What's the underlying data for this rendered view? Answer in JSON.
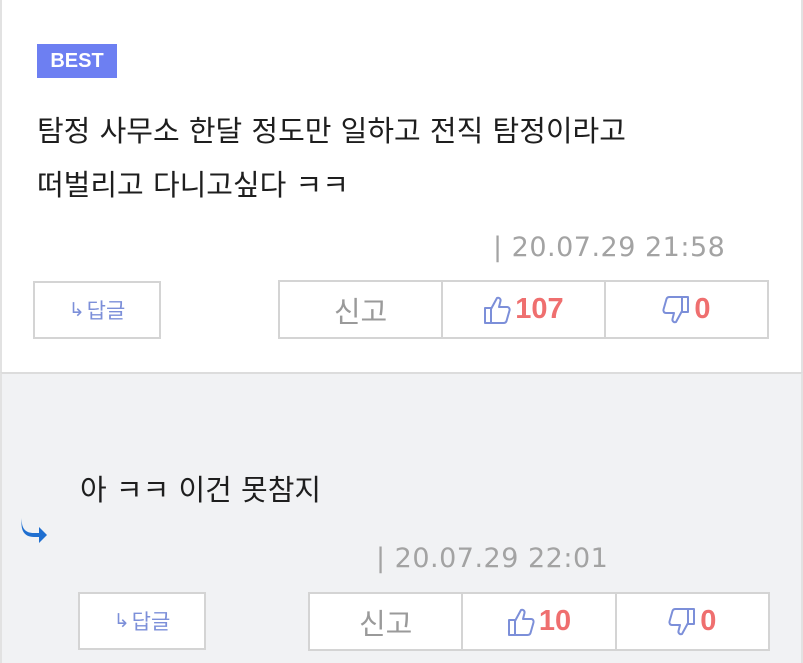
{
  "best_comment": {
    "badge": "BEST",
    "text_line1": "탐정 사무소 한달 정도만 일하고 전직 탐정이라고",
    "text_line2": "떠벌리고 다니고싶다 ㅋㅋ",
    "timestamp": "| 20.07.29 21:58",
    "reply_label": "답글",
    "report_label": "신고",
    "like_count": "107",
    "dislike_count": "0"
  },
  "reply_comment": {
    "text": "아 ㅋㅋ 이건 못참지",
    "timestamp": "| 20.07.29 22:01",
    "reply_label": "답글",
    "report_label": "신고",
    "like_count": "10",
    "dislike_count": "0"
  },
  "colors": {
    "best_badge": "#6d7ff2",
    "count_red": "#ef6f6f",
    "thumb_blue": "#7c8fd9",
    "reply_arrow_blue": "#1f6fd0",
    "reply_bg": "#f1f2f4"
  },
  "icons": {
    "like": "thumbs-up-icon",
    "dislike": "thumbs-down-icon",
    "reply_arrow": "reply-arrow-icon",
    "reply_indicator": "reply-indicator-icon"
  }
}
